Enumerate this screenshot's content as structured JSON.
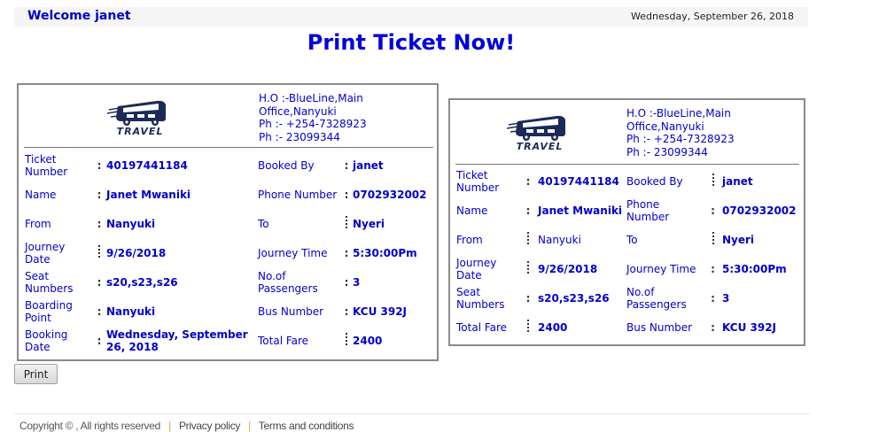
{
  "header": {
    "welcome": "Welcome janet",
    "date": "Wednesday, September 26, 2018"
  },
  "page_title": "Print Ticket Now!",
  "logo": {
    "brand": "TRAVEL",
    "icon": "bus-icon"
  },
  "office": {
    "line1": "H.O :-BlueLine,Main",
    "line2": "Office,Nanyuki",
    "line3": "Ph :- +254-7328923",
    "line4": "Ph :- 23099344"
  },
  "ticket_left": {
    "rows": [
      {
        "l1": "Ticket Number",
        "v1": "40197441184",
        "l2": "Booked By",
        "v2": "janet"
      },
      {
        "l1": "Name",
        "v1": "Janet Mwaniki",
        "l2": "Phone Number",
        "v2": "0702932002"
      },
      {
        "l1": "From",
        "v1": "Nanyuki",
        "l2": "To",
        "v2": "Nyeri"
      },
      {
        "l1": "Journey Date",
        "v1": "9/26/2018",
        "l2": "Journey Time",
        "v2": "5:30:00Pm"
      },
      {
        "l1": "Seat Numbers",
        "v1": "s20,s23,s26",
        "l2": "No.of Passengers",
        "v2": "3"
      },
      {
        "l1": "Boarding Point",
        "v1": "Nanyuki",
        "l2": "Bus Number",
        "v2": "KCU 392J"
      },
      {
        "l1": "Booking Date",
        "v1": "Wednesday, September 26, 2018",
        "l2": "Total Fare",
        "v2": "2400"
      }
    ]
  },
  "ticket_right": {
    "rows": [
      {
        "l1": "Ticket Number",
        "v1": "40197441184",
        "l2": "Booked By",
        "v2": "janet"
      },
      {
        "l1": "Name",
        "v1": "Janet Mwaniki",
        "l2": "Phone Number",
        "v2": "0702932002"
      },
      {
        "l1": "From",
        "v1": "Nanyuki",
        "l2": "To",
        "v2": "Nyeri"
      },
      {
        "l1": "Journey Date",
        "v1": "9/26/2018",
        "l2": "Journey Time",
        "v2": "5:30:00Pm"
      },
      {
        "l1": "Seat Numbers",
        "v1": "s20,s23,s26",
        "l2": "No.of Passengers",
        "v2": "3"
      },
      {
        "l1": "Total Fare",
        "v1": "2400",
        "l2": "Bus Number",
        "v2": "KCU 392J"
      }
    ]
  },
  "print_label": "Print",
  "footer": {
    "copyright": "Copyright © , All rights reserved",
    "privacy": "Privacy policy",
    "terms": "Terms and conditions",
    "separator": "|"
  }
}
